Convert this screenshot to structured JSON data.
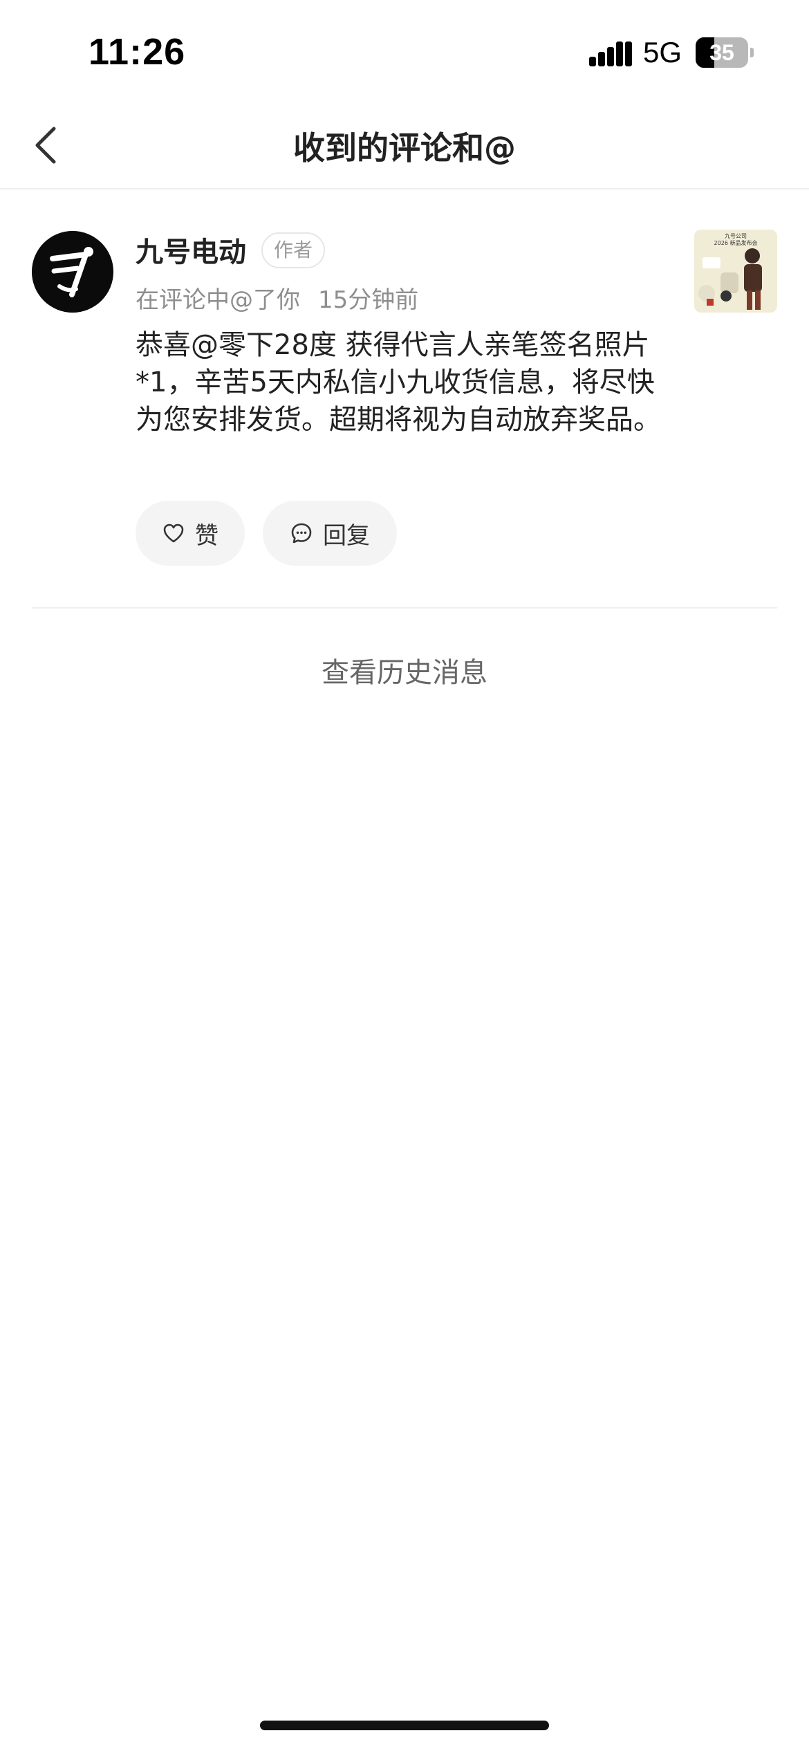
{
  "status_bar": {
    "time": "11:26",
    "network": "5G",
    "battery_level": "35",
    "battery_fraction": 0.35,
    "signal_icon": "cellular-signal-icon",
    "battery_icon": "battery-icon"
  },
  "nav": {
    "title": "收到的评论和@",
    "back_icon": "chevron-left-icon"
  },
  "notification": {
    "user_name": "九号电动",
    "badge": "作者",
    "action_text": "在评论中@了你",
    "time": "15分钟前",
    "comment": "恭喜@零下28度  获得代言人亲笔签名照片*1，辛苦5天内私信小九收货信息，将尽快为您安排发货。超期将视为自动放弃奖品。",
    "like_label": "赞",
    "reply_label": "回复",
    "like_icon": "heart-icon",
    "reply_icon": "comment-bubble-icon",
    "thumbnail_lines": [
      "九号公司",
      "2026 新品发布会"
    ]
  },
  "history_link": "查看历史消息",
  "colors": {
    "background": "#ffffff",
    "text_primary": "#222222",
    "text_secondary": "#8e8e8e",
    "button_bg": "#f4f4f4",
    "avatar_bg": "#0b0b0b"
  }
}
